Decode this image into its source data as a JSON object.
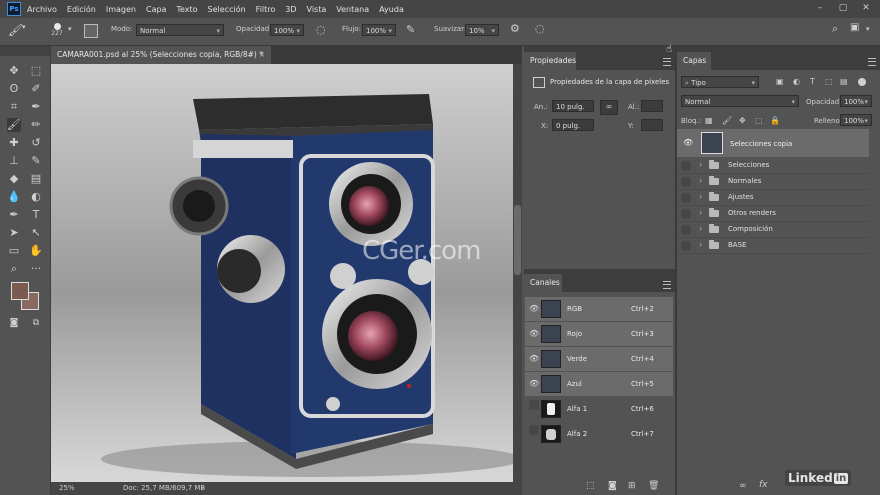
{
  "menubar": {
    "items": [
      "Archivo",
      "Edición",
      "Imagen",
      "Capa",
      "Texto",
      "Selección",
      "Filtro",
      "3D",
      "Vista",
      "Ventana",
      "Ayuda"
    ],
    "app_icon": "Ps"
  },
  "options": {
    "brush_size": "227",
    "mode_label": "Modo:",
    "mode_value": "Normal",
    "opacity_label": "Opacidad:",
    "opacity_value": "100%",
    "flow_label": "Flujo:",
    "flow_value": "100%",
    "smooth_label": "Suavizar:",
    "smooth_value": "10%"
  },
  "document": {
    "tab_title": "CAMARA001.psd al 25% (Selecciones copia, RGB/8#) *",
    "zoom": "25%",
    "doc_info": "Doc: 25,7 MB/609,7 MB",
    "watermark": "CGer.com"
  },
  "properties": {
    "tab": "Propiedades",
    "title": "Propiedades de la capa de píxeles",
    "an_label": "An.:",
    "an_value": "10 pulg.",
    "al_label": "Al.:",
    "x_label": "X:",
    "x_value": "0 pulg.",
    "y_label": "Y:"
  },
  "channels": {
    "tab": "Canales",
    "items": [
      {
        "name": "RGB",
        "key": "Ctrl+2",
        "visible": true
      },
      {
        "name": "Rojo",
        "key": "Ctrl+3",
        "visible": true
      },
      {
        "name": "Verde",
        "key": "Ctrl+4",
        "visible": true
      },
      {
        "name": "Azul",
        "key": "Ctrl+5",
        "visible": true
      },
      {
        "name": "Alfa 1",
        "key": "Ctrl+6",
        "visible": false
      },
      {
        "name": "Alfa 2",
        "key": "Ctrl+7",
        "visible": false
      }
    ]
  },
  "layers": {
    "tab": "Capas",
    "filter": "Tipo",
    "blend": "Normal",
    "opacity_label": "Opacidad:",
    "opacity_value": "100%",
    "lock_label": "Bloq.:",
    "fill_label": "Relleno:",
    "fill_value": "100%",
    "selected_layer": "Selecciones copia",
    "groups": [
      "Selecciones",
      "Normales",
      "Ajustes",
      "Otros renders",
      "Composición",
      "BASE"
    ]
  },
  "branding": {
    "logo_text": "Linked",
    "logo_box": "in"
  },
  "colors": {
    "foreground": "#7b5a52",
    "background": "#8a6a60",
    "camera_body": "#1f3565"
  }
}
